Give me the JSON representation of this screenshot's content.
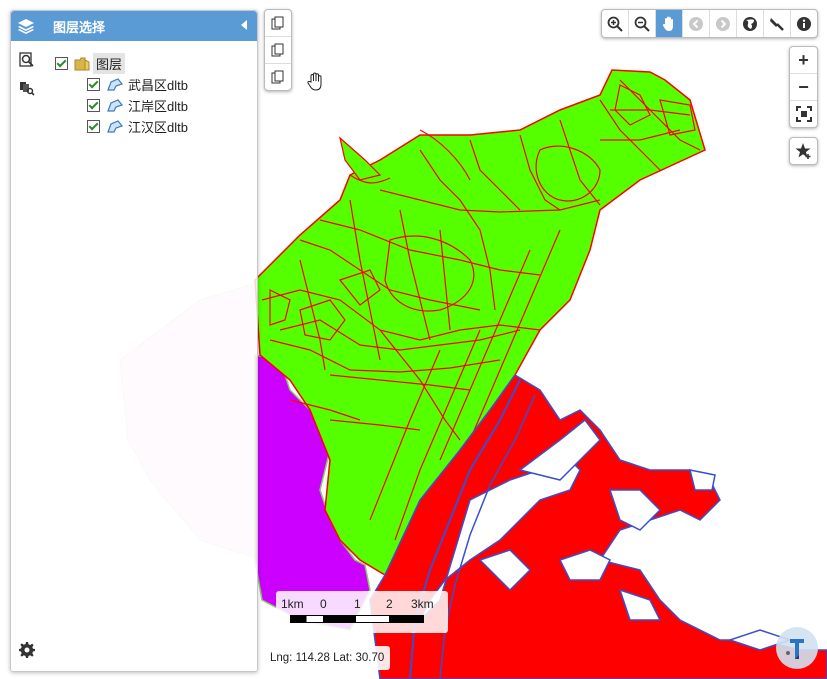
{
  "panel": {
    "title": "图层选择",
    "tree": {
      "root": {
        "label": "图层",
        "checked": true
      },
      "layers": [
        {
          "label": "武昌区dltb",
          "checked": true
        },
        {
          "label": "江岸区dltb",
          "checked": true
        },
        {
          "label": "江汉区dltb",
          "checked": true
        }
      ]
    },
    "side_tools": [
      "layer-search-icon",
      "layer-query-icon"
    ],
    "settings_icon": "gear-icon"
  },
  "toolbar": {
    "buttons": [
      {
        "icon": "zoom-in-icon",
        "active": false
      },
      {
        "icon": "zoom-out-icon",
        "active": false
      },
      {
        "icon": "pan-hand-icon",
        "active": true
      },
      {
        "icon": "previous-extent-icon",
        "active": false
      },
      {
        "icon": "next-extent-icon",
        "active": false
      },
      {
        "icon": "full-extent-globe-icon",
        "active": false
      },
      {
        "icon": "measure-icon",
        "active": false
      },
      {
        "icon": "info-icon",
        "active": false
      }
    ]
  },
  "zoom": {
    "in_label": "+",
    "out_label": "−"
  },
  "scale_bar": {
    "labels": [
      "1km",
      "0",
      "1",
      "2",
      "3km"
    ]
  },
  "coordinates": {
    "text": "Lng: 114.28 Lat: 30.70"
  },
  "colors": {
    "accent": "#5b9bd5",
    "wuchang_fill": "#ff0000",
    "jiangan_fill": "#55ff00",
    "jianghan_fill": "#cc00ff",
    "boundary_red": "#ff0000",
    "river_outline": "#3a4fd0"
  }
}
